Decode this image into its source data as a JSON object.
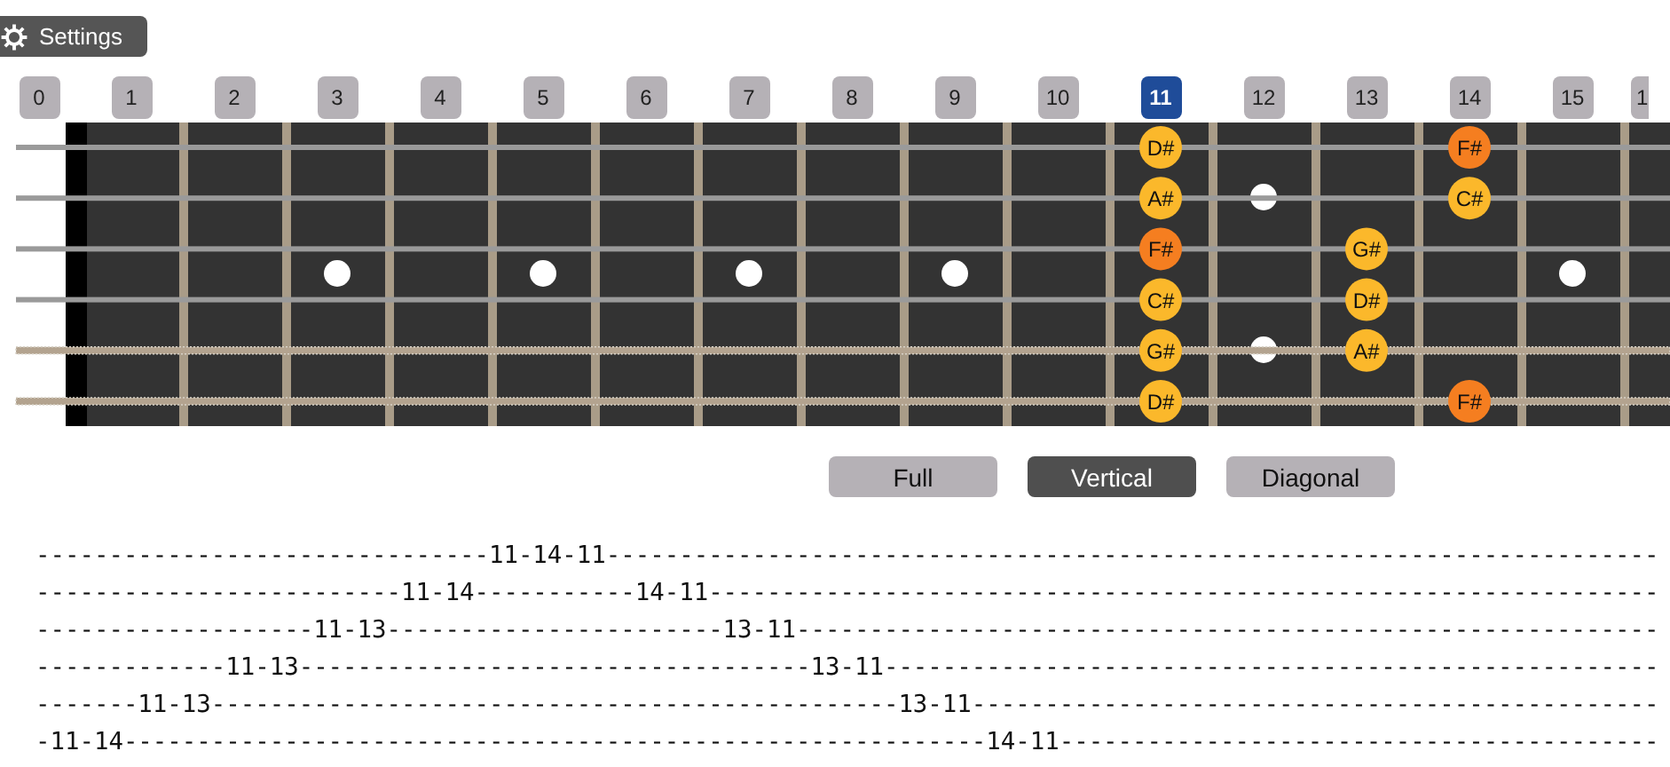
{
  "settings_button": {
    "label": "Settings"
  },
  "frets": [
    {
      "label": "0",
      "selected": false,
      "kind": "none"
    },
    {
      "label": "1",
      "selected": false,
      "kind": "none"
    },
    {
      "label": "2",
      "selected": false,
      "kind": "none"
    },
    {
      "label": "3",
      "selected": false,
      "kind": "single"
    },
    {
      "label": "4",
      "selected": false,
      "kind": "none"
    },
    {
      "label": "5",
      "selected": false,
      "kind": "single"
    },
    {
      "label": "6",
      "selected": false,
      "kind": "none"
    },
    {
      "label": "7",
      "selected": false,
      "kind": "single"
    },
    {
      "label": "8",
      "selected": false,
      "kind": "none"
    },
    {
      "label": "9",
      "selected": false,
      "kind": "single"
    },
    {
      "label": "10",
      "selected": false,
      "kind": "none"
    },
    {
      "label": "11",
      "selected": true,
      "kind": "none"
    },
    {
      "label": "12",
      "selected": false,
      "kind": "double"
    },
    {
      "label": "13",
      "selected": false,
      "kind": "none"
    },
    {
      "label": "14",
      "selected": false,
      "kind": "none"
    },
    {
      "label": "15",
      "selected": false,
      "kind": "single"
    },
    {
      "label": "1",
      "selected": false,
      "kind": "none"
    }
  ],
  "strings": [
    {
      "kind": "plain",
      "cells": [
        {
          "kind": "empty"
        },
        {
          "kind": "empty"
        },
        {
          "kind": "empty"
        },
        {
          "kind": "empty"
        },
        {
          "kind": "empty"
        },
        {
          "kind": "empty"
        },
        {
          "kind": "empty"
        },
        {
          "kind": "empty"
        },
        {
          "kind": "empty"
        },
        {
          "kind": "empty"
        },
        {
          "kind": "empty"
        },
        {
          "kind": "note",
          "label": "D#",
          "color": "#fbb82b"
        },
        {
          "kind": "empty"
        },
        {
          "kind": "empty"
        },
        {
          "kind": "note",
          "label": "F#",
          "color": "#f57e20"
        }
      ]
    },
    {
      "kind": "plain",
      "cells": [
        {
          "kind": "empty"
        },
        {
          "kind": "empty"
        },
        {
          "kind": "empty"
        },
        {
          "kind": "empty"
        },
        {
          "kind": "empty"
        },
        {
          "kind": "empty"
        },
        {
          "kind": "empty"
        },
        {
          "kind": "empty"
        },
        {
          "kind": "empty"
        },
        {
          "kind": "empty"
        },
        {
          "kind": "empty"
        },
        {
          "kind": "note",
          "label": "A#",
          "color": "#fbb82b"
        },
        {
          "kind": "empty"
        },
        {
          "kind": "empty"
        },
        {
          "kind": "note",
          "label": "C#",
          "color": "#fbb82b"
        }
      ]
    },
    {
      "kind": "plain",
      "cells": [
        {
          "kind": "empty"
        },
        {
          "kind": "empty"
        },
        {
          "kind": "empty"
        },
        {
          "kind": "empty"
        },
        {
          "kind": "empty"
        },
        {
          "kind": "empty"
        },
        {
          "kind": "empty"
        },
        {
          "kind": "empty"
        },
        {
          "kind": "empty"
        },
        {
          "kind": "empty"
        },
        {
          "kind": "empty"
        },
        {
          "kind": "note",
          "label": "F#",
          "color": "#f57e20"
        },
        {
          "kind": "empty"
        },
        {
          "kind": "note",
          "label": "G#",
          "color": "#fbb82b"
        }
      ]
    },
    {
      "kind": "plain",
      "cells": [
        {
          "kind": "empty"
        },
        {
          "kind": "empty"
        },
        {
          "kind": "empty"
        },
        {
          "kind": "empty"
        },
        {
          "kind": "empty"
        },
        {
          "kind": "empty"
        },
        {
          "kind": "empty"
        },
        {
          "kind": "empty"
        },
        {
          "kind": "empty"
        },
        {
          "kind": "empty"
        },
        {
          "kind": "empty"
        },
        {
          "kind": "note",
          "label": "C#",
          "color": "#fbb82b"
        },
        {
          "kind": "empty"
        },
        {
          "kind": "note",
          "label": "D#",
          "color": "#fbb82b"
        }
      ]
    },
    {
      "kind": "wound",
      "cells": [
        {
          "kind": "empty"
        },
        {
          "kind": "empty"
        },
        {
          "kind": "empty"
        },
        {
          "kind": "empty"
        },
        {
          "kind": "empty"
        },
        {
          "kind": "empty"
        },
        {
          "kind": "empty"
        },
        {
          "kind": "empty"
        },
        {
          "kind": "empty"
        },
        {
          "kind": "empty"
        },
        {
          "kind": "empty"
        },
        {
          "kind": "note",
          "label": "G#",
          "color": "#fbb82b"
        },
        {
          "kind": "empty"
        },
        {
          "kind": "note",
          "label": "A#",
          "color": "#fbb82b"
        }
      ]
    },
    {
      "kind": "wound",
      "cells": [
        {
          "kind": "empty"
        },
        {
          "kind": "empty"
        },
        {
          "kind": "empty"
        },
        {
          "kind": "empty"
        },
        {
          "kind": "empty"
        },
        {
          "kind": "empty"
        },
        {
          "kind": "empty"
        },
        {
          "kind": "empty"
        },
        {
          "kind": "empty"
        },
        {
          "kind": "empty"
        },
        {
          "kind": "empty"
        },
        {
          "kind": "note",
          "label": "D#",
          "color": "#fbb82b"
        },
        {
          "kind": "empty"
        },
        {
          "kind": "empty"
        },
        {
          "kind": "note",
          "label": "F#",
          "color": "#f57e20"
        }
      ]
    }
  ],
  "modes": [
    {
      "label": "Full",
      "selected": false
    },
    {
      "label": "Vertical",
      "selected": true
    },
    {
      "label": "Diagonal",
      "selected": false
    }
  ],
  "tab_lines": [
    "-------------------------------11-14-11------------------------------------------------------------------------",
    "-------------------------11-14-----------14-11-----------------------------------------------------------------",
    "-------------------11-13-----------------------13-11-----------------------------------------------------------",
    "-------------11-13-----------------------------------13-11-----------------------------------------------------",
    "-------11-13-----------------------------------------------13-11-----------------------------------------------",
    "-11-14-----------------------------------------------------------14-11-----------------------------------------"
  ]
}
